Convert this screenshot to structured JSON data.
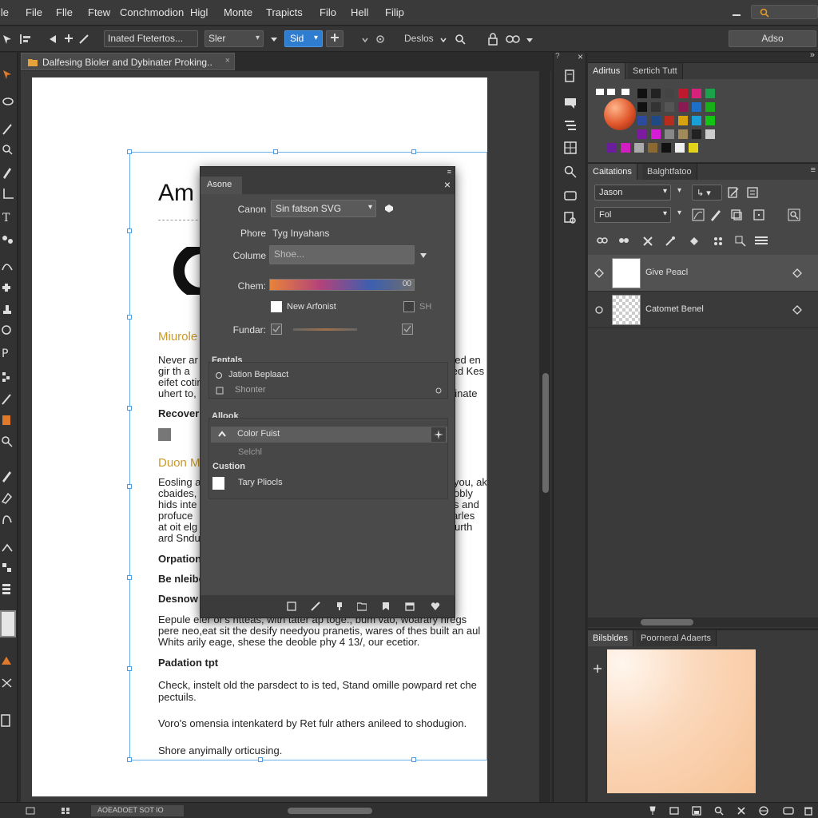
{
  "menubar": {
    "items": [
      "ile",
      "File",
      "Flle",
      "Ftew",
      "Conchmodion",
      "Higl",
      "Monte",
      "Trapicts",
      "Filo",
      "Hell",
      "Filip"
    ]
  },
  "options_bar": {
    "preset_label": "Inated Ftetertos...",
    "mode_select": "Sler",
    "blue_button": "Sid",
    "density_label": "Deslos",
    "right_button": "Adso"
  },
  "document": {
    "tab_title": "Dalfesing Bioler and Dybinater Proking..",
    "heading": "Am",
    "section1_title": "Miurole",
    "para1": [
      "Never ar",
      "gir th a",
      "eifet cotin",
      "uhert to,"
    ],
    "para1_right": [
      "ged en",
      "ted Kes",
      "",
      "ginate"
    ],
    "recover_label": "Recover s",
    "section2_title": "Duon M",
    "para2": [
      "Eosling a",
      "cbaides,",
      "hids inte",
      "profuce",
      "at oit elg",
      "ard Sndu"
    ],
    "para2_right": [
      "you, ak",
      "obly",
      "s and",
      "ngerarles",
      "onsurth",
      ""
    ],
    "h_options": "Orpation",
    "h_benible": "Be nleibe",
    "h_desinow": "Desnow",
    "para3": [
      "Eepule eler or's htteas, with tater ap toge., bum vao, woarary nregs",
      "pere neo,eat sit the desify needyou pranetis, wares of thes built an aul",
      "Whits arily eage, shese the deoble phy 4 13/, our ecetior."
    ],
    "h_padation": "Padation tpt",
    "para4": [
      "Check, instelt old the parsdect to is ted, Stand omille powpard ret che",
      "pectuils."
    ],
    "para5": "Voro's omensia intenkaterd by Ret fulr athers anileed to shodugion.",
    "para6": "Shore anyimally orticusing."
  },
  "dialog": {
    "tab": "Asone",
    "canon_label": "Canon",
    "canon_value": "Sin fatson SVG",
    "phore_label": "Phore",
    "phore_value": "Tyg Inyahans",
    "colume_label": "Colume",
    "colume_placeholder": "Shoe...",
    "chem_label": "Chem:",
    "chem_value": "00",
    "check_label": "New Arfonist",
    "check_right": "SH",
    "fundar_label": "Fundar:",
    "section_fentals": "Fentals",
    "opt1": "Jation Beplaact",
    "opt2": "Shonter",
    "section_allock": "Allook",
    "color_fist": "Color Fuist",
    "selchl": "Selchl",
    "custion": "Custion",
    "tary_pliocls": "Tary Pliocls"
  },
  "right_panels": {
    "top_tabs": [
      "Adirtus",
      "Sertich Tutt"
    ],
    "mid_tabs": [
      "Caitations",
      "Balghtfatoo"
    ],
    "mid_select1": "Jason",
    "mid_select2": "Fol",
    "layers": [
      "Give Peacl",
      "Catomet Benel"
    ],
    "bottom_tabs": [
      "Bilsbldes",
      "Poorneral Adaerts"
    ]
  },
  "statusbar": {
    "text": "AOEADOET SOT IO"
  },
  "colors": {
    "accent": "#2f7dd1",
    "selection": "#6ab0e8",
    "gold": "#c99a2a"
  }
}
